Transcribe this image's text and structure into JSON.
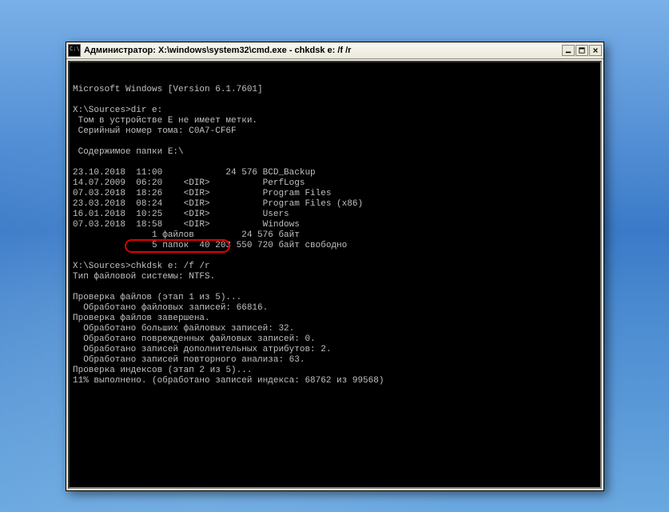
{
  "window": {
    "title": "Администратор: X:\\windows\\system32\\cmd.exe - chkdsk  e: /f /r"
  },
  "console": {
    "lines": [
      "Microsoft Windows [Version 6.1.7601]",
      "",
      "X:\\Sources>dir e:",
      " Том в устройстве E не имеет метки.",
      " Серийный номер тома: C0A7-CF6F",
      "",
      " Содержимое папки E:\\",
      "",
      "23.10.2018  11:00            24 576 BCD_Backup",
      "14.07.2009  06:20    <DIR>          PerfLogs",
      "07.03.2018  18:26    <DIR>          Program Files",
      "23.03.2018  08:24    <DIR>          Program Files (x86)",
      "16.01.2018  10:25    <DIR>          Users",
      "07.03.2018  18:58    <DIR>          Windows",
      "               1 файлов         24 576 байт",
      "               5 папок  40 203 550 720 байт свободно",
      "",
      "X:\\Sources>chkdsk e: /f /r",
      "Тип файловой системы: NTFS.",
      "",
      "Проверка файлов (этап 1 из 5)...",
      "  Обработано файловых записей: 66816.",
      "Проверка файлов завершена.",
      "  Обработано больших файловых записей: 32.",
      "  Обработано поврежденных файловых записей: 0.",
      "  Обработано записей дополнительных атрибутов: 2.",
      "  Обработано записей повторного анализа: 63.",
      "Проверка индексов (этап 2 из 5)...",
      "11% выполнено. (обработано записей индекса: 68762 из 99568)"
    ]
  },
  "annotation": {
    "highlighted_command": "chkdsk e: /f /r"
  }
}
